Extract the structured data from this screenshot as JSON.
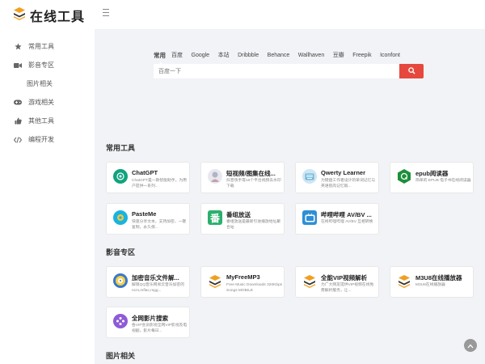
{
  "logo": {
    "text": "在线工具",
    "icon": "stack-layers-icon",
    "accent": "#f0a020"
  },
  "sidebar": {
    "items": [
      {
        "label": "常用工具",
        "icon": "star-icon"
      },
      {
        "label": "影音专区",
        "icon": "video-camera-icon"
      },
      {
        "label": "图片相关",
        "icon": ""
      },
      {
        "label": "游戏相关",
        "icon": "gamepad-icon"
      },
      {
        "label": "其他工具",
        "icon": "thumbs-up-icon"
      },
      {
        "label": "编程开发",
        "icon": "code-icon"
      }
    ]
  },
  "search": {
    "tabs": [
      "常用",
      "百度",
      "Google",
      "本站",
      "Dribbble",
      "Behance",
      "Wallhaven",
      "豆瓣",
      "Freepik",
      "Iconfont"
    ],
    "placeholder": "百度一下",
    "button_color": "#e6483d"
  },
  "sections": {
    "common": {
      "title": "常用工具",
      "cards": [
        {
          "title": "ChatGPT",
          "desc": "ChatGPT是一款智能助手，为用户提供一系列..."
        },
        {
          "title": "短视频/图集在线...",
          "desc": "抖音快手等16个平台视频去水印下载"
        },
        {
          "title": "Qwerty Learner",
          "desc": "为键盘工作者设计的单词记忆与英语肌肉记忆锻..."
        },
        {
          "title": "epub阅读器",
          "desc": "简单的 EPUB 电子书在线阅读器"
        },
        {
          "title": "PasteMe",
          "desc": "快速分享文本，支持加密，一键复制，永久保..."
        },
        {
          "title": "番组放送",
          "desc": "番组放送是最新引进播放地址聚合站"
        },
        {
          "title": "哔哩哔哩 AV/BV ...",
          "desc": "在线哔哩哔哩 AV/BV 互相转换"
        }
      ]
    },
    "media": {
      "title": "影音专区",
      "cards": [
        {
          "title": "加密音乐文件解...",
          "desc": "解锁QQ音乐网易云音乐加密的ncm,mflac,mgg..."
        },
        {
          "title": "MyFreeMP3",
          "desc": "Free Music Downloads 320Kbps Songs MOBILE"
        },
        {
          "title": "全能VIP视频解析",
          "desc": "为广大网友提供VIP视频在线免费解析服务，让..."
        },
        {
          "title": "M3U8在线播放器",
          "desc": "M3U8在线播放器"
        },
        {
          "title": "全网影片搜索",
          "desc": "各VIP会员影视全网VIP影视及电视剧，影片每日..."
        }
      ]
    },
    "images": {
      "title": "图片相关"
    }
  }
}
